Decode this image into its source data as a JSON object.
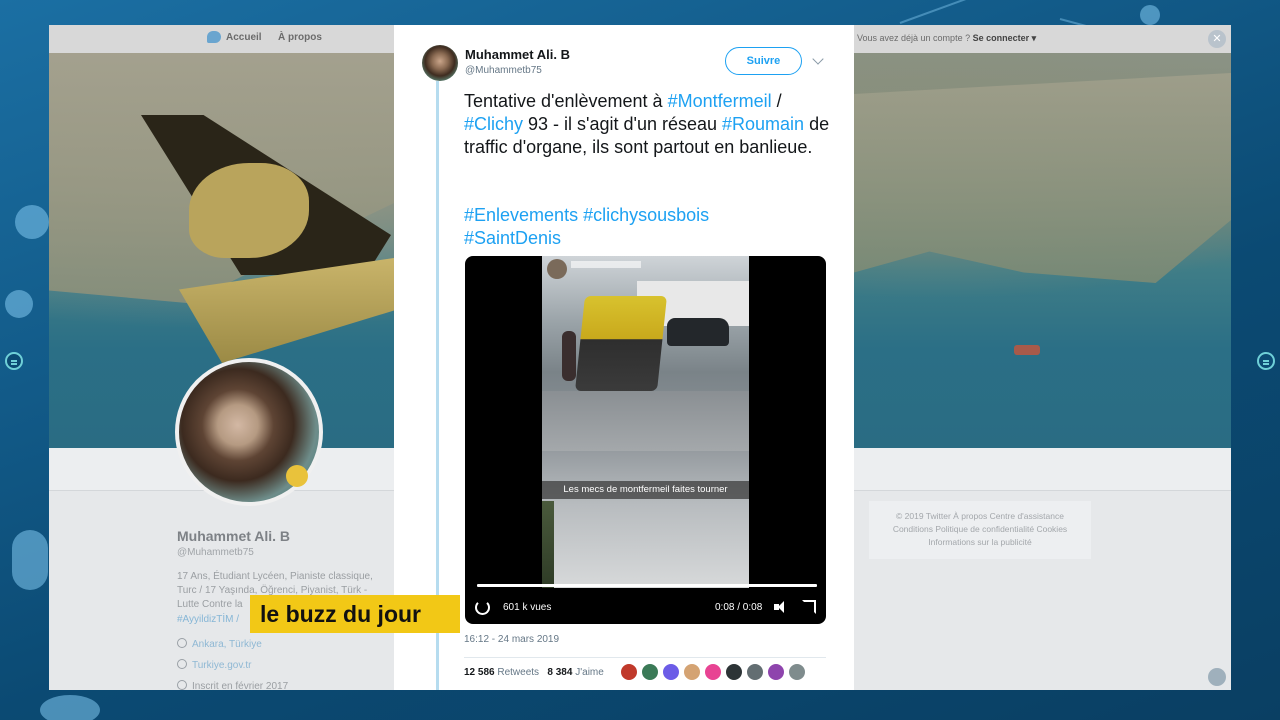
{
  "twitter_nav": {
    "home": "Accueil",
    "about": "À propos",
    "login_prompt": "Vous avez déjà un compte ?",
    "login_link": "Se connecter ▾"
  },
  "profile": {
    "name": "Muhammet Ali. B",
    "handle": "@Muhammetb75",
    "bio": "17 Ans, Étudiant Lycéen, Pianiste classique, Turc / 17 Yaşında, Öğrenci, Piyanist, Türk - Lutte Contre la",
    "tag": "#AyyildizTİM /",
    "location": "Ankara, Türkiye",
    "website": "Turkiye.gov.tr",
    "joined": "Inscrit en février 2017"
  },
  "footer": {
    "line1": "© 2019 Twitter   À propos   Centre d'assistance",
    "line2": "Conditions   Politique de confidentialité   Cookies",
    "line3": "Informations sur la publicité"
  },
  "tweet": {
    "author_name": "Muhammet Ali. B",
    "author_handle": "@Muhammetb75",
    "follow_label": "Suivre",
    "text_p1": "Tentative d'enlèvement à ",
    "tag_montfermeil": "#Montfermeil",
    "text_p2": " / ",
    "tag_clichy": "#Clichy",
    "text_p3": " 93 - il s'agit d'un réseau ",
    "tag_roumain": "#Roumain",
    "text_p4": " de traffic d'organe, ils sont partout en banlieue.",
    "tags_line1": "#Enlevements #clichysousbois",
    "tags_line2": "#SaintDenis",
    "video": {
      "caption": "Les mecs de montfermeil faites tourner",
      "views": "601 k vues",
      "time": "0:08 / 0:08",
      "progress": 1.0
    },
    "date": "16:12 - 24 mars 2019",
    "retweets_count": "12 586",
    "retweets_label": "Retweets",
    "likes_count": "8 384",
    "likes_label": "J'aime"
  },
  "liker_colors": [
    "#c0392b",
    "#3b7a57",
    "#6c5ce7",
    "#d4a373",
    "#e84393",
    "#2d3436",
    "#636e72",
    "#8e44ad",
    "#7f8c8d"
  ],
  "lower_third": {
    "label": "le buzz du jour",
    "color": "#f2c816"
  }
}
